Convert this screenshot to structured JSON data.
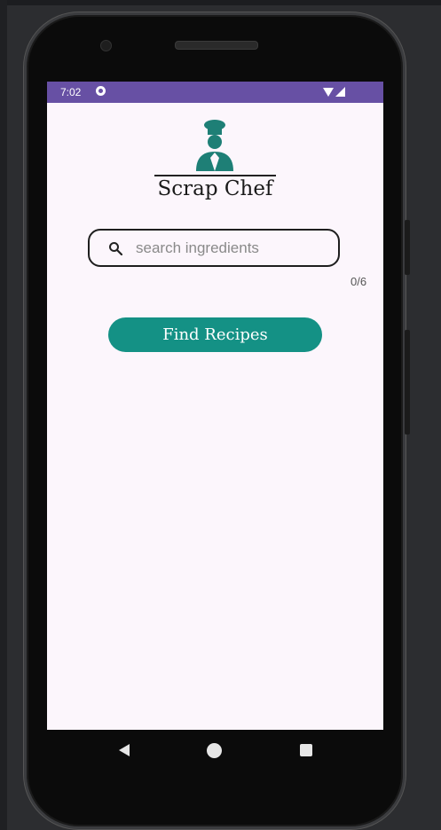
{
  "status_bar": {
    "time": "7:02",
    "icons": [
      "sync-icon",
      "wifi-icon",
      "signal-icon"
    ],
    "background": "#6750a4"
  },
  "header": {
    "logo_icon": "chef-icon",
    "title": "Scrap Chef"
  },
  "search": {
    "icon": "search-icon",
    "placeholder": "search ingredients",
    "value": "",
    "counter": "0/6"
  },
  "actions": {
    "find_label": "Find Recipes",
    "accent": "#149185"
  },
  "nav_bar": {
    "icons": [
      "back-icon",
      "home-icon",
      "recents-icon"
    ]
  }
}
